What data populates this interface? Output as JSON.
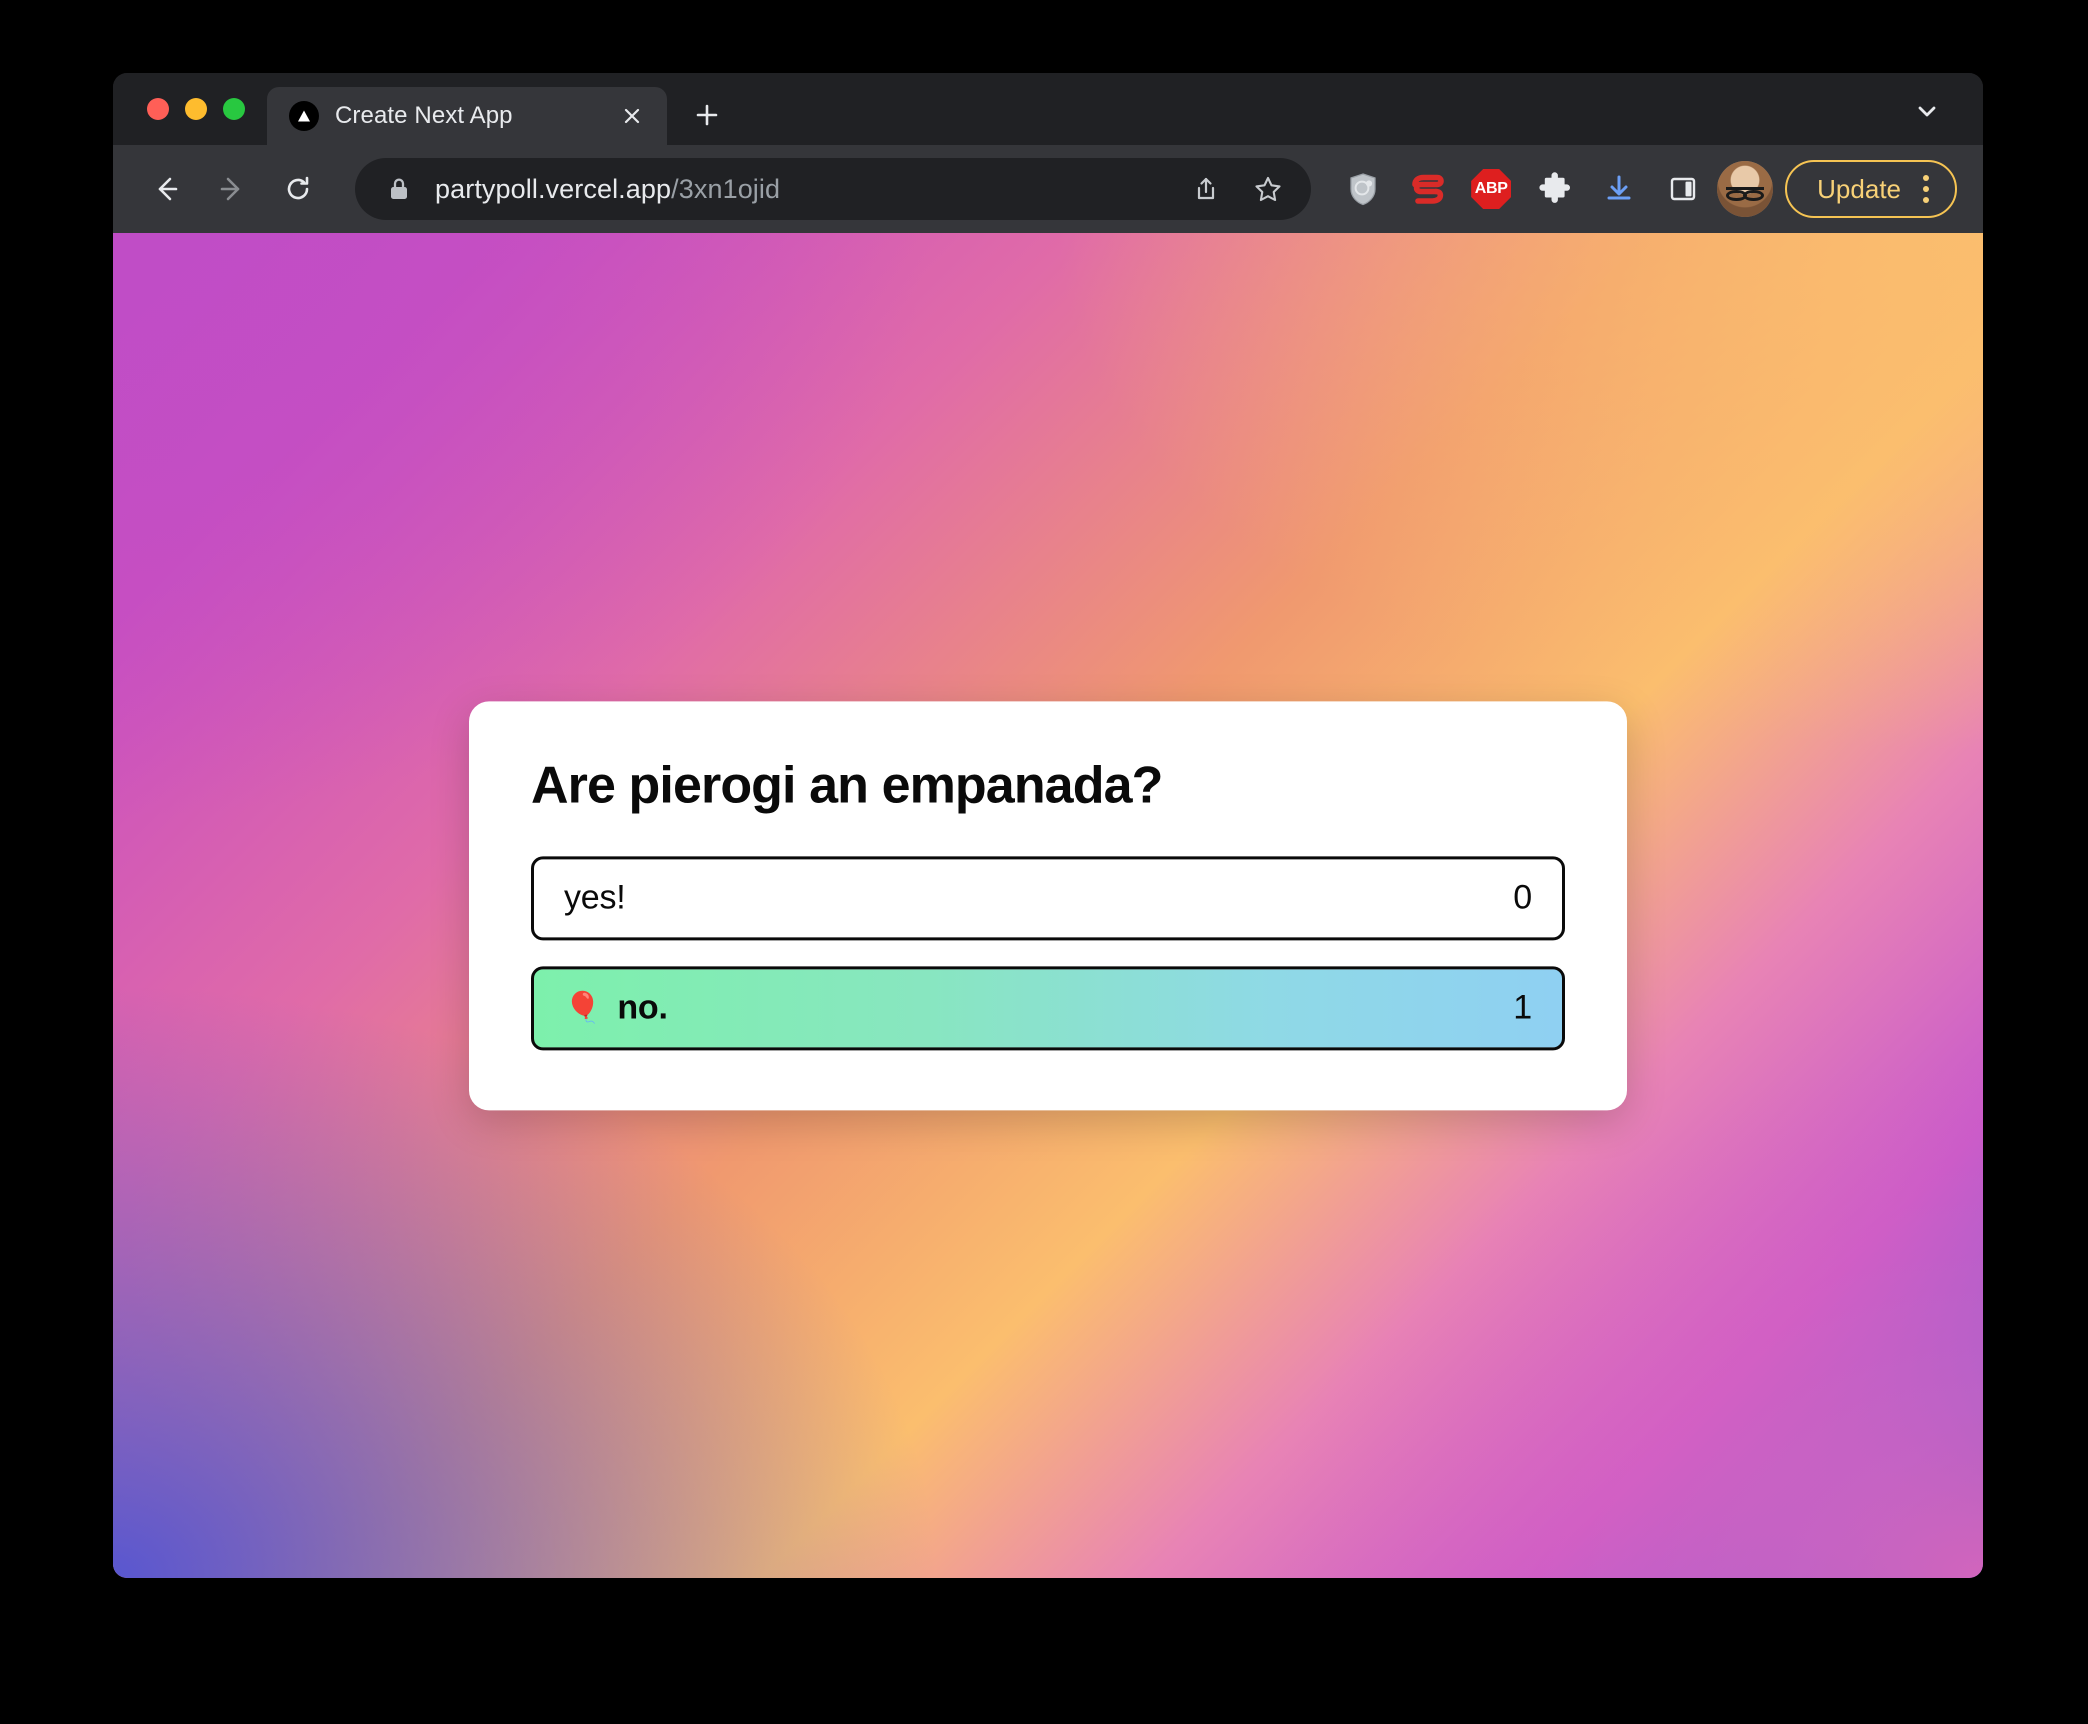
{
  "window": {
    "traffic_lights": [
      "close",
      "minimize",
      "maximize"
    ]
  },
  "tab_strip": {
    "active_tab": {
      "title": "Create Next App",
      "favicon": "nextjs-triangle-icon",
      "close_label": "×"
    },
    "new_tab_label": "+",
    "tab_list_chevron": "chevron-down-icon"
  },
  "toolbar": {
    "back_label": "←",
    "forward_label": "→",
    "reload_label": "reload-icon",
    "omnibox": {
      "lock": "lock-icon",
      "url_domain": "partypoll.vercel.app",
      "url_path": "/3xn1ojid",
      "share_icon": "share-icon",
      "bookmark_icon": "star-icon"
    },
    "extensions": [
      {
        "name": "privacy-shield-extension",
        "label": ""
      },
      {
        "name": "expressvpn-extension",
        "label": ""
      },
      {
        "name": "adblock-plus-extension",
        "label": "ABP"
      },
      {
        "name": "extensions-puzzle",
        "label": ""
      },
      {
        "name": "downloads-button",
        "label": ""
      },
      {
        "name": "side-panel-button",
        "label": ""
      }
    ],
    "profile_avatar": "user-avatar",
    "update_button_label": "Update",
    "menu_icon": "kebab-menu-icon"
  },
  "page": {
    "background_colors": {
      "top_left": "#C04DC6",
      "top_right": "#FBBE6E",
      "bottom_left": "#5154D4",
      "bottom_right": "#E067BA"
    },
    "poll": {
      "question": "Are pierogi an empanada?",
      "options": [
        {
          "label": "yes!",
          "count": "0",
          "emoji": "",
          "voted": false
        },
        {
          "label": "no.",
          "count": "1",
          "emoji": "🎈",
          "voted": true
        }
      ],
      "voted_gradient_start": "#7DF0AC",
      "voted_gradient_end": "#8FD0F2"
    }
  }
}
